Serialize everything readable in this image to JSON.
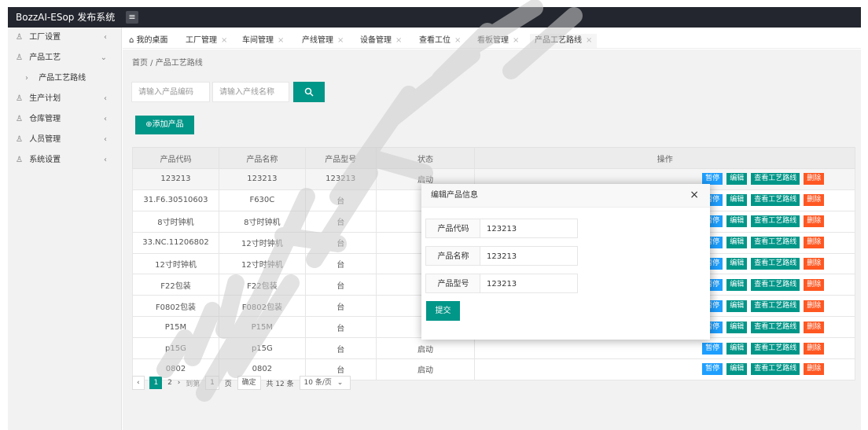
{
  "app": {
    "title": "BozzAI-ESop 发布系统",
    "menu_toggle": "≡"
  },
  "sidebar": {
    "items": [
      {
        "label": "工厂设置",
        "icon": "person-icon",
        "arrow": "‹"
      },
      {
        "label": "产品工艺",
        "icon": "person-icon",
        "arrow": "⌄"
      },
      {
        "label": "产品工艺路线",
        "icon": "chevron-right-icon",
        "sub": true
      },
      {
        "label": "生产计划",
        "icon": "person-icon",
        "arrow": "‹"
      },
      {
        "label": "仓库管理",
        "icon": "person-icon",
        "arrow": "‹"
      },
      {
        "label": "人员管理",
        "icon": "person-icon",
        "arrow": "‹"
      },
      {
        "label": "系统设置",
        "icon": "person-icon",
        "arrow": "‹"
      }
    ]
  },
  "tabs": [
    {
      "label": "我的桌面",
      "icon": "home-icon",
      "close": ""
    },
    {
      "label": "工厂管理",
      "close": "×"
    },
    {
      "label": "车间管理",
      "close": "×"
    },
    {
      "label": "产线管理",
      "close": "×"
    },
    {
      "label": "设备管理",
      "close": "×"
    },
    {
      "label": "查看工位",
      "close": "×"
    },
    {
      "label": "看板管理",
      "close": "×"
    },
    {
      "label": "产品工艺路线",
      "close": "×"
    }
  ],
  "breadcrumb": "首页 / 产品工艺路线",
  "search": {
    "code_placeholder": "请输入产品编码",
    "name_placeholder": "请输入产线名称",
    "button_icon": "search-icon"
  },
  "add_button": "⊕添加产品",
  "table": {
    "headers": [
      "产品代码",
      "产品名称",
      "产品型号",
      "状态",
      "操作"
    ],
    "rows": [
      {
        "code": "123213",
        "name": "123213",
        "model": "123213",
        "status": "启动"
      },
      {
        "code": "31.F6.30510603",
        "name": "F630C",
        "model": "台",
        "status": ""
      },
      {
        "code": "8寸时钟机",
        "name": "8寸时钟机",
        "model": "台",
        "status": ""
      },
      {
        "code": "33.NC.11206802",
        "name": "12寸时钟机",
        "model": "台",
        "status": ""
      },
      {
        "code": "12寸时钟机",
        "name": "12寸时钟机",
        "model": "台",
        "status": ""
      },
      {
        "code": "F22包装",
        "name": "F22包装",
        "model": "台",
        "status": ""
      },
      {
        "code": "F0802包装",
        "name": "F0802包装",
        "model": "台",
        "status": ""
      },
      {
        "code": "P15M",
        "name": "P15M",
        "model": "台",
        "status": ""
      },
      {
        "code": "p15G",
        "name": "p15G",
        "model": "台",
        "status": "启动"
      },
      {
        "code": "0802",
        "name": "0802",
        "model": "台",
        "status": "启动"
      }
    ],
    "actions": {
      "pause": "暂停",
      "edit": "编辑",
      "route": "查看工艺路线",
      "delete": "删除"
    }
  },
  "pager": {
    "prev": "‹",
    "pages": [
      "1",
      "2"
    ],
    "next": "›",
    "goto_label": "到第",
    "goto_value": "1",
    "page_unit": "页",
    "confirm": "确定",
    "total": "共 12 条",
    "per_page": "10 条/页"
  },
  "modal": {
    "title": "编辑产品信息",
    "close": "×",
    "fields": [
      {
        "label": "产品代码",
        "value": "123213"
      },
      {
        "label": "产品名称",
        "value": "123213"
      },
      {
        "label": "产品型号",
        "value": "123213"
      }
    ],
    "submit": "提交"
  },
  "watermark": {
    "text": "深圳博时",
    "color": "#cccccc"
  },
  "colors": {
    "primary": "#009688",
    "header": "#23262e",
    "pause": "#1e9fff",
    "danger": "#ff5722"
  }
}
